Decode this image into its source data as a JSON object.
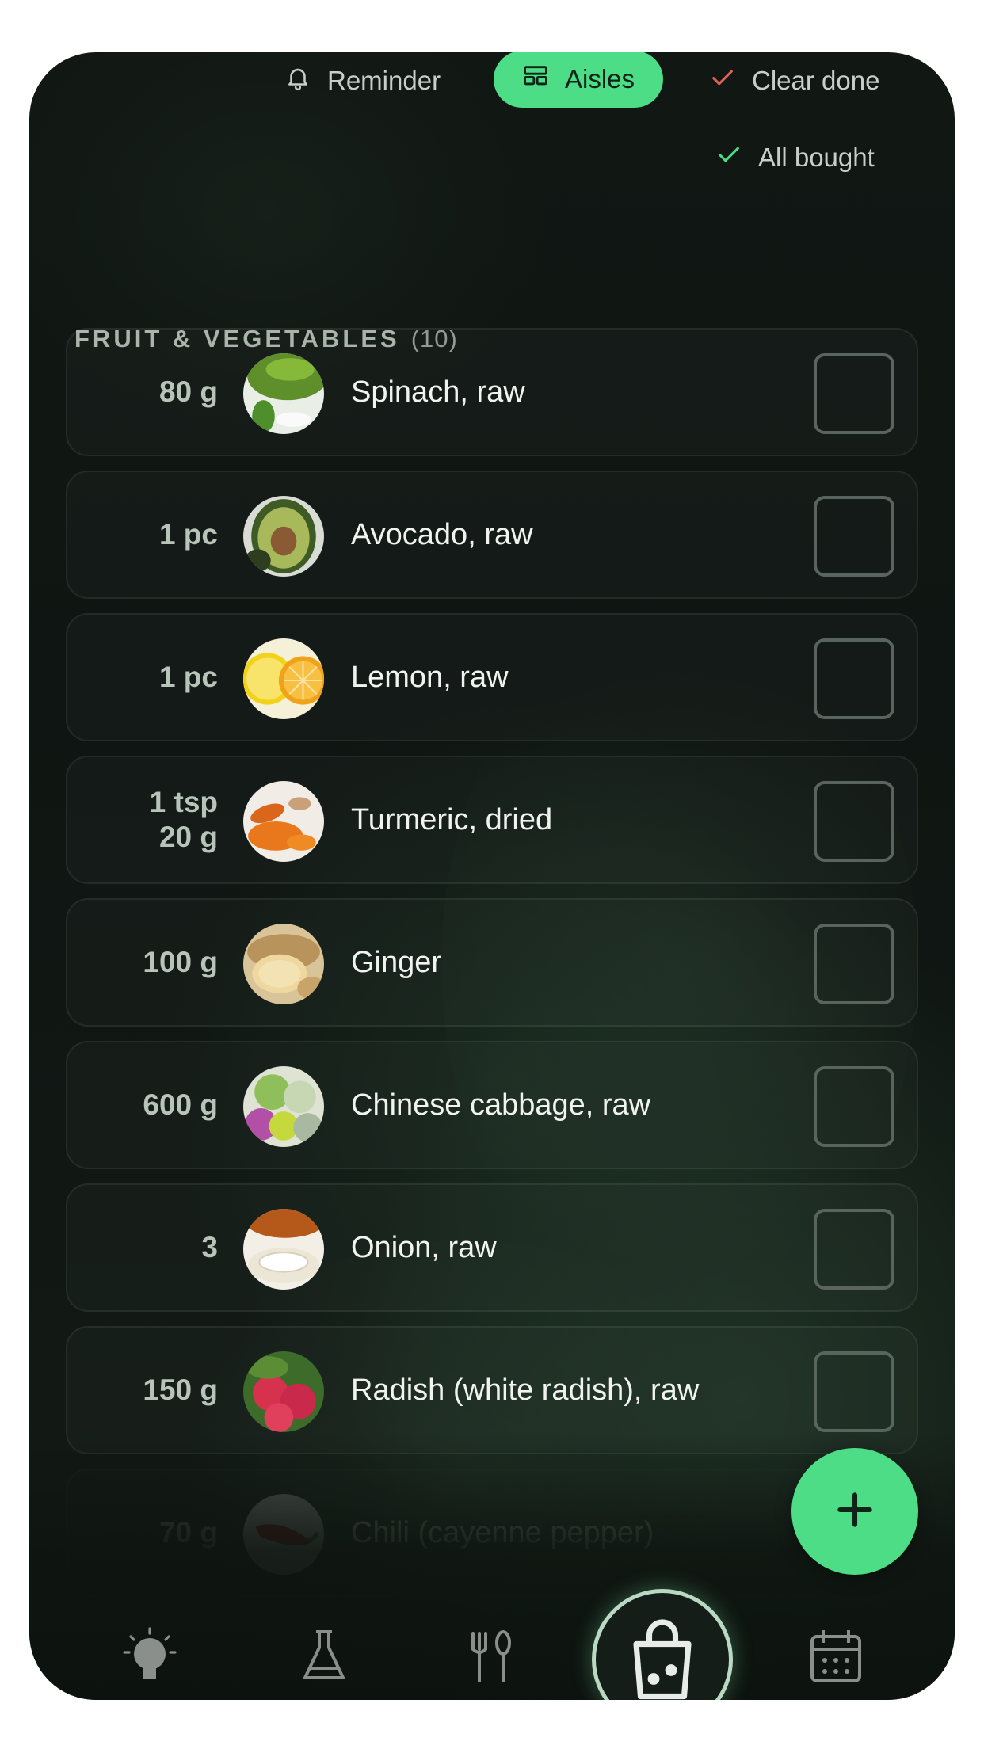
{
  "toolbar": {
    "reminder_label": "Reminder",
    "aisles_label": "Aisles",
    "clear_done_label": "Clear done",
    "all_bought_label": "All bought"
  },
  "section": {
    "title": "FRUIT & VEGETABLES",
    "count": "(10)"
  },
  "items": [
    {
      "qty1": "80 g",
      "qty2": "",
      "name": "Spinach, raw",
      "image": "spinach-image"
    },
    {
      "qty1": "1 pc",
      "qty2": "",
      "name": "Avocado, raw",
      "image": "avocado-image"
    },
    {
      "qty1": "1 pc",
      "qty2": "",
      "name": "Lemon, raw",
      "image": "lemon-image"
    },
    {
      "qty1": "1 tsp",
      "qty2": "20 g",
      "name": "Turmeric, dried",
      "image": "turmeric-image"
    },
    {
      "qty1": "100 g",
      "qty2": "",
      "name": "Ginger",
      "image": "ginger-image"
    },
    {
      "qty1": "600 g",
      "qty2": "",
      "name": "Chinese cabbage, raw",
      "image": "cabbage-image"
    },
    {
      "qty1": "3",
      "qty2": "",
      "name": "Onion, raw",
      "image": "onion-image"
    },
    {
      "qty1": "150 g",
      "qty2": "",
      "name": "Radish (white radish), raw",
      "image": "radish-image"
    },
    {
      "qty1": "70 g",
      "qty2": "",
      "name": "Chili (cayenne pepper)",
      "image": "chili-image"
    }
  ],
  "nav": {
    "items": [
      "lightbulb-icon",
      "flask-icon",
      "cutlery-icon",
      "shopping-bag-icon",
      "calendar-icon"
    ],
    "active": "shopping-bag-icon"
  },
  "colors": {
    "accent": "#4cdd86",
    "background": "#111713",
    "clear_done_check": "#e0605a",
    "all_bought_check": "#4cdd86"
  }
}
